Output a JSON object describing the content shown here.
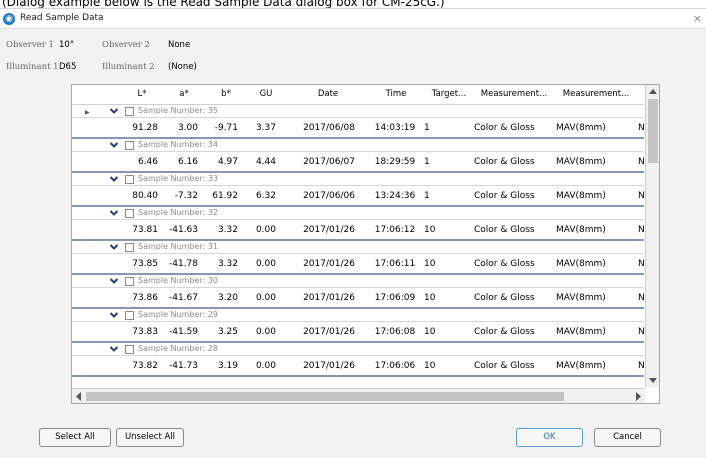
{
  "caption": "(Dialog example below is the Read Sample Data dialog box for CM-25cG.)",
  "window": {
    "title": "Read Sample Data",
    "close_glyph": "×"
  },
  "info": {
    "observer1_label": "Observer 1",
    "observer1_value": "10°",
    "observer2_label": "Observer 2",
    "observer2_value": "None",
    "illuminant1_label": "Illuminant 1",
    "illuminant1_value": "D65",
    "illuminant2_label": "Illuminant 2",
    "illuminant2_value": "(None)"
  },
  "table": {
    "columns": [
      "L*",
      "a*",
      "b*",
      "GU",
      "Date",
      "Time",
      "Target...",
      "Measurement...",
      "Measurement..."
    ],
    "groups": [
      {
        "label": "Sample Number: 35",
        "values": [
          "91.28",
          "3.00",
          "-9.71",
          "3.37",
          "2017/06/08",
          "14:03:19",
          "1",
          "Color & Gloss",
          "MAV(8mm)",
          "N"
        ]
      },
      {
        "label": "Sample Number: 34",
        "values": [
          "6.46",
          "6.16",
          "4.97",
          "4.44",
          "2017/06/07",
          "18:29:59",
          "1",
          "Color & Gloss",
          "MAV(8mm)",
          "N"
        ]
      },
      {
        "label": "Sample Number: 33",
        "values": [
          "80.40",
          "-7.32",
          "61.92",
          "6.32",
          "2017/06/06",
          "13:24:36",
          "1",
          "Color & Gloss",
          "MAV(8mm)",
          "N"
        ]
      },
      {
        "label": "Sample Number: 32",
        "values": [
          "73.81",
          "-41.63",
          "3.32",
          "0.00",
          "2017/01/26",
          "17:06:12",
          "10",
          "Color & Gloss",
          "MAV(8mm)",
          "N"
        ]
      },
      {
        "label": "Sample Number: 31",
        "values": [
          "73.85",
          "-41.78",
          "3.32",
          "0.00",
          "2017/01/26",
          "17:06:11",
          "10",
          "Color & Gloss",
          "MAV(8mm)",
          "N"
        ]
      },
      {
        "label": "Sample Number: 30",
        "values": [
          "73.86",
          "-41.67",
          "3.20",
          "0.00",
          "2017/01/26",
          "17:06:09",
          "10",
          "Color & Gloss",
          "MAV(8mm)",
          "N"
        ]
      },
      {
        "label": "Sample Number: 29",
        "values": [
          "73.83",
          "-41.59",
          "3.25",
          "0.00",
          "2017/01/26",
          "17:06:08",
          "10",
          "Color & Gloss",
          "MAV(8mm)",
          "N"
        ]
      },
      {
        "label": "Sample Number: 28",
        "values": [
          "73.82",
          "-41.73",
          "3.19",
          "0.00",
          "2017/01/26",
          "17:06:06",
          "10",
          "Color & Gloss",
          "MAV(8mm)",
          "N"
        ]
      }
    ]
  },
  "buttons": {
    "select_all": "Select All",
    "unselect_all": "Unselect All",
    "ok": "OK",
    "cancel": "Cancel"
  },
  "colors": {
    "accent": "#1a78c8",
    "row_divider": "#8a97b3",
    "ok_border": "#5b9bd5"
  }
}
